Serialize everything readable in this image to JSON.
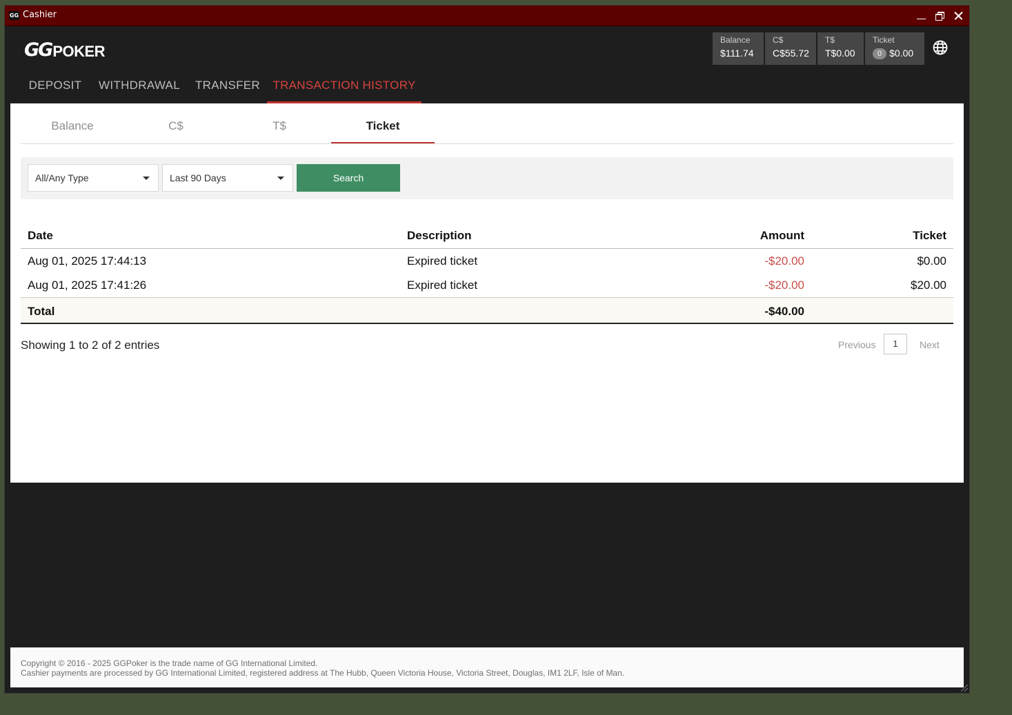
{
  "window": {
    "title": "Cashier",
    "app_icon": "GG"
  },
  "header": {
    "logo_gg": "GG",
    "logo_poker": "POKER",
    "balances": [
      {
        "label": "Balance",
        "value": "$111.74"
      },
      {
        "label": "C$",
        "value": "C$55.72"
      },
      {
        "label": "T$",
        "value": "T$0.00"
      },
      {
        "label": "Ticket",
        "count": "0",
        "value": "$0.00"
      }
    ],
    "language_icon": "globe-icon"
  },
  "nav": {
    "tabs": [
      {
        "label": "DEPOSIT"
      },
      {
        "label": "WITHDRAWAL"
      },
      {
        "label": "TRANSFER"
      },
      {
        "label": "TRANSACTION HISTORY",
        "active": true
      }
    ]
  },
  "subtabs": [
    {
      "label": "Balance"
    },
    {
      "label": "C$"
    },
    {
      "label": "T$"
    },
    {
      "label": "Ticket",
      "active": true
    }
  ],
  "filters": {
    "type": "All/Any Type",
    "period": "Last 90 Days",
    "search_label": "Search"
  },
  "table": {
    "headers": {
      "date": "Date",
      "description": "Description",
      "amount": "Amount",
      "ticket": "Ticket"
    },
    "rows": [
      {
        "date": "Aug 01, 2025 17:44:13",
        "description": "Expired ticket",
        "amount": "-$20.00",
        "ticket": "$0.00"
      },
      {
        "date": "Aug 01, 2025 17:41:26",
        "description": "Expired ticket",
        "amount": "-$20.00",
        "ticket": "$20.00"
      }
    ],
    "total_label": "Total",
    "total_amount": "-$40.00"
  },
  "pagination": {
    "summary": "Showing 1 to 2 of 2 entries",
    "previous": "Previous",
    "page": "1",
    "next": "Next"
  },
  "footer": {
    "line1": "Copyright © 2016 - 2025 GGPoker is the trade name of GG International Limited.",
    "line2": "Cashier payments are processed by GG International Limited, registered address at The Hubb, Queen Victoria House, Victoria Street, Douglas, IM1 2LF, Isle of Man."
  },
  "colors": {
    "titlebar": "#5c0000",
    "accent_red": "#c0332e",
    "search_green": "#3f8e63",
    "negative": "#c94d48"
  }
}
